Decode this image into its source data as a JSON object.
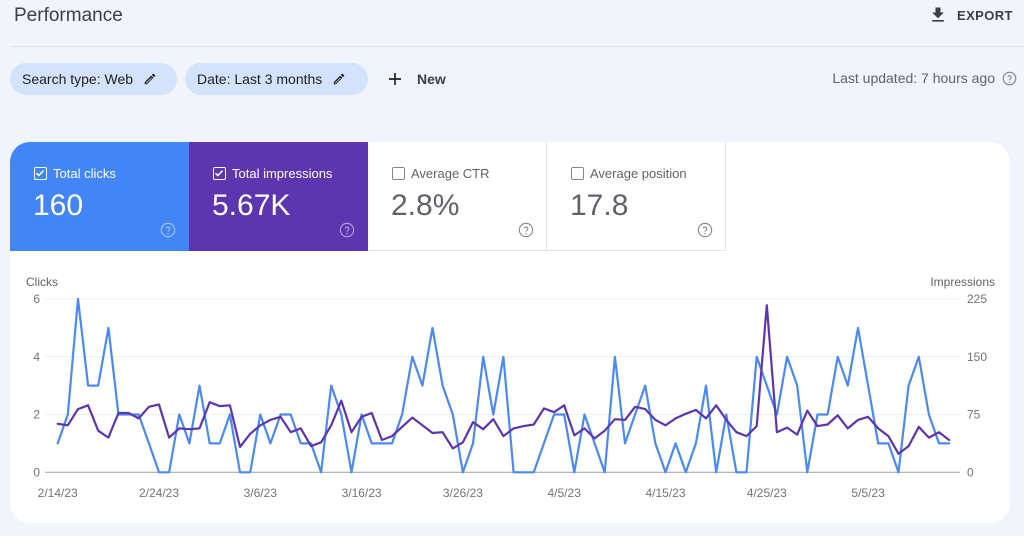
{
  "header": {
    "title": "Performance",
    "export_label": "EXPORT",
    "export_icon": "download-icon"
  },
  "filters": {
    "chips": [
      {
        "label": "Search type: Web",
        "icon": "edit-icon"
      },
      {
        "label": "Date: Last 3 months",
        "icon": "edit-icon"
      }
    ],
    "new_label": "New",
    "new_icon": "plus-icon",
    "last_updated": "Last updated: 7 hours ago",
    "help_icon": "help-icon"
  },
  "metrics": [
    {
      "label": "Total clicks",
      "value": "160",
      "checked": true,
      "color": "#4285f4"
    },
    {
      "label": "Total impressions",
      "value": "5.67K",
      "checked": true,
      "color": "#5e35b1"
    },
    {
      "label": "Average CTR",
      "value": "2.8%",
      "checked": false
    },
    {
      "label": "Average position",
      "value": "17.8",
      "checked": false
    }
  ],
  "chart_data": {
    "type": "line",
    "title": "",
    "grid": true,
    "legend": "none",
    "left_axis": {
      "label": "Clicks",
      "range": [
        0,
        6
      ],
      "ticks": [
        0,
        2,
        4,
        6
      ]
    },
    "right_axis": {
      "label": "Impressions",
      "range": [
        0,
        225
      ],
      "ticks": [
        0,
        75,
        150,
        225
      ]
    },
    "x_tick_labels": [
      "2/14/23",
      "2/24/23",
      "3/6/23",
      "3/16/23",
      "3/26/23",
      "4/5/23",
      "4/15/23",
      "4/25/23",
      "5/5/23"
    ],
    "x": [
      "2/14/23",
      "2/15/23",
      "2/16/23",
      "2/17/23",
      "2/18/23",
      "2/19/23",
      "2/20/23",
      "2/21/23",
      "2/22/23",
      "2/23/23",
      "2/24/23",
      "2/25/23",
      "2/26/23",
      "2/27/23",
      "2/28/23",
      "3/1/23",
      "3/2/23",
      "3/3/23",
      "3/4/23",
      "3/5/23",
      "3/6/23",
      "3/7/23",
      "3/8/23",
      "3/9/23",
      "3/10/23",
      "3/11/23",
      "3/12/23",
      "3/13/23",
      "3/14/23",
      "3/15/23",
      "3/16/23",
      "3/17/23",
      "3/18/23",
      "3/19/23",
      "3/20/23",
      "3/21/23",
      "3/22/23",
      "3/23/23",
      "3/24/23",
      "3/25/23",
      "3/26/23",
      "3/27/23",
      "3/28/23",
      "3/29/23",
      "3/30/23",
      "3/31/23",
      "4/1/23",
      "4/2/23",
      "4/3/23",
      "4/4/23",
      "4/5/23",
      "4/6/23",
      "4/7/23",
      "4/8/23",
      "4/9/23",
      "4/10/23",
      "4/11/23",
      "4/12/23",
      "4/13/23",
      "4/14/23",
      "4/15/23",
      "4/16/23",
      "4/17/23",
      "4/18/23",
      "4/19/23",
      "4/20/23",
      "4/21/23",
      "4/22/23",
      "4/23/23",
      "4/24/23",
      "4/25/23",
      "4/26/23",
      "4/27/23",
      "4/28/23",
      "4/29/23",
      "4/30/23",
      "5/1/23",
      "5/2/23",
      "5/3/23",
      "5/4/23",
      "5/5/23",
      "5/6/23",
      "5/7/23",
      "5/8/23",
      "5/9/23",
      "5/10/23",
      "5/11/23",
      "5/12/23",
      "5/13/23"
    ],
    "series": [
      {
        "name": "Clicks",
        "axis": "left",
        "color": "#4a8af4",
        "values": [
          1,
          2,
          6,
          3,
          3,
          5,
          2,
          2,
          2,
          1,
          0,
          0,
          2,
          1,
          3,
          1,
          1,
          2,
          0,
          0,
          2,
          1,
          2,
          2,
          1,
          1,
          0,
          3,
          2,
          0,
          2,
          1,
          1,
          1,
          2,
          4,
          3,
          5,
          3,
          2,
          0,
          1,
          4,
          2,
          4,
          0,
          0,
          0,
          1,
          2,
          2,
          0,
          2,
          1,
          0,
          4,
          1,
          2,
          3,
          1,
          0,
          1,
          0,
          1,
          3,
          0,
          2,
          0,
          0,
          4,
          3,
          2,
          4,
          3,
          0,
          2,
          2,
          4,
          3,
          5,
          3,
          1,
          1,
          0,
          3,
          4,
          2,
          1,
          1
        ]
      },
      {
        "name": "Impressions",
        "axis": "right",
        "color": "#5e35b1",
        "values": [
          63,
          61,
          82,
          87,
          54,
          45,
          77,
          77,
          70,
          85,
          88,
          45,
          57,
          56,
          57,
          91,
          86,
          87,
          33,
          50,
          61,
          68,
          72,
          52,
          57,
          34,
          39,
          61,
          93,
          52,
          72,
          77,
          42,
          47,
          59,
          71,
          61,
          51,
          52,
          31,
          39,
          65,
          56,
          69,
          47,
          57,
          60,
          62,
          83,
          78,
          87,
          48,
          57,
          44,
          54,
          69,
          68,
          85,
          82,
          68,
          61,
          70,
          76,
          81,
          70,
          87,
          68,
          52,
          47,
          60,
          217,
          52,
          58,
          49,
          80,
          60,
          62,
          74,
          57,
          68,
          72,
          57,
          47,
          24,
          34,
          59,
          45,
          52,
          42
        ]
      }
    ]
  }
}
